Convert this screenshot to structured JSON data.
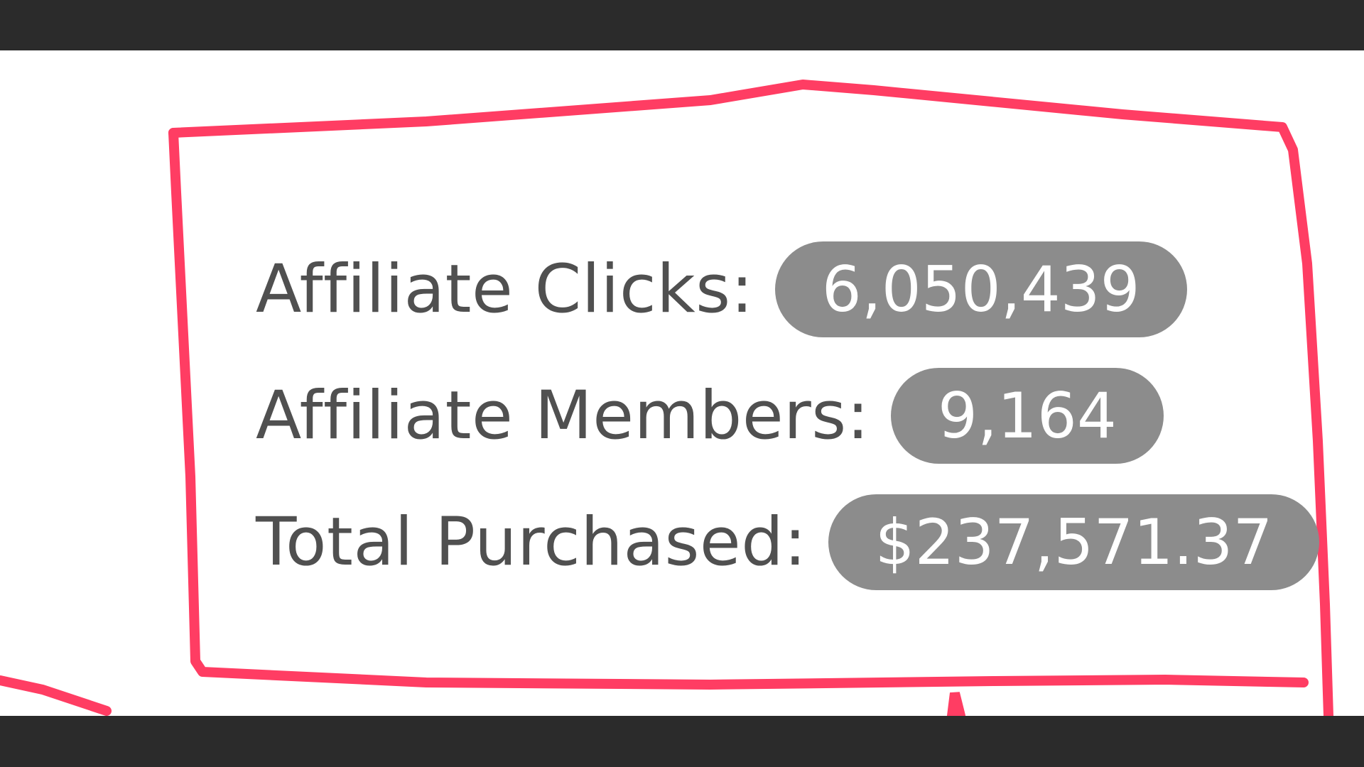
{
  "annotation": {
    "stroke_color": "#ff3d63"
  },
  "stats": [
    {
      "label": "Affiliate Clicks:",
      "value": "6,050,439"
    },
    {
      "label": "Affiliate Members:",
      "value": "9,164"
    },
    {
      "label": "Total Purchased:",
      "value": "$237,571.37"
    }
  ],
  "colors": {
    "text": "#505050",
    "badge_bg": "#8c8c8c",
    "badge_text": "#ffffff",
    "frame": "#2b2b2b"
  }
}
